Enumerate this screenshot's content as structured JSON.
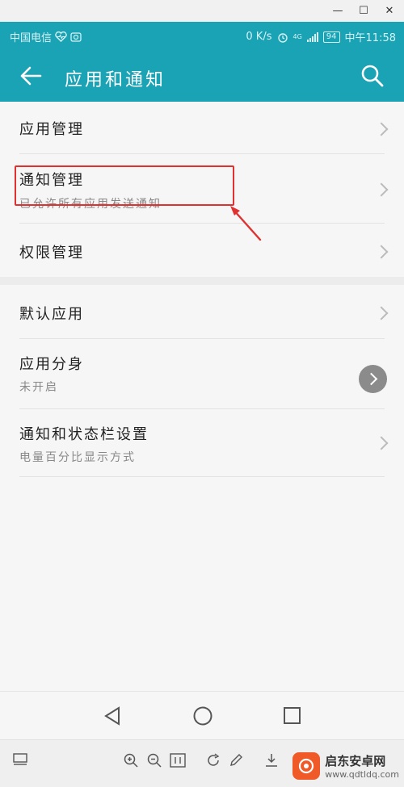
{
  "window": {
    "min_glyph": "—",
    "max_glyph": "☐",
    "close_glyph": "✕"
  },
  "status": {
    "carrier": "中国电信",
    "speed": "0 K/s",
    "network": "4G",
    "battery": "94",
    "time": "中午11:58"
  },
  "header": {
    "title": "应用和通知",
    "back_icon": "arrow-left-icon",
    "search_icon": "search-icon"
  },
  "list": [
    {
      "title": "应用管理"
    },
    {
      "title": "通知管理",
      "subtitle": "已允许所有应用发送通知"
    },
    {
      "title": "权限管理"
    },
    {
      "title": "默认应用"
    },
    {
      "title": "应用分身",
      "subtitle": "未开启"
    },
    {
      "title": "通知和状态栏设置",
      "subtitle": "电量百分比显示方式"
    }
  ],
  "watermark": {
    "title": "启东安卓网",
    "url": "www.qdtldq.com"
  },
  "colors": {
    "primary": "#1aa3b5",
    "annotation": "#e03030"
  }
}
